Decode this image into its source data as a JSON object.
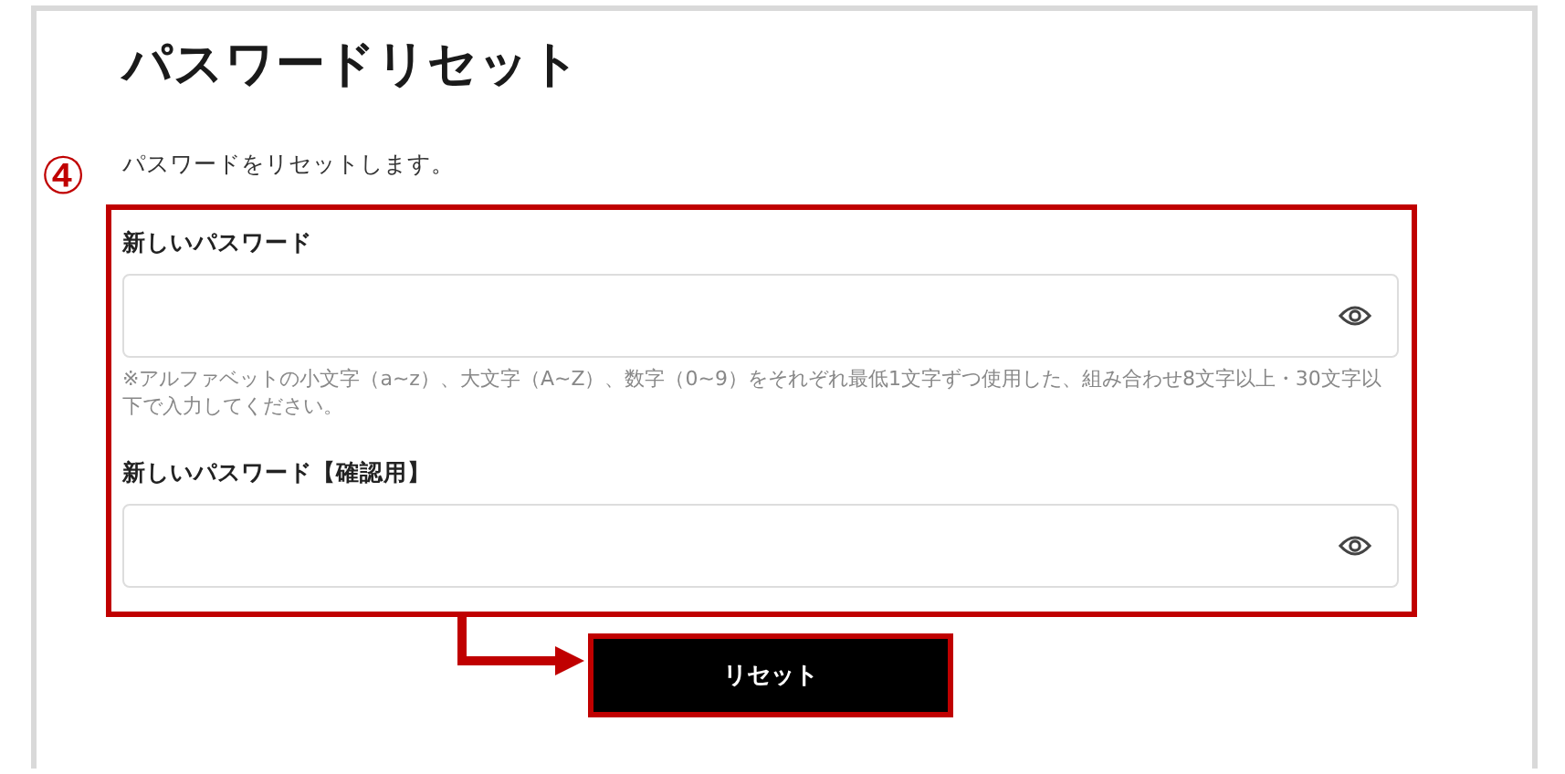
{
  "title": "パスワードリセット",
  "description": "パスワードをリセットします。",
  "annotation": {
    "marker": "④"
  },
  "fields": [
    {
      "label": "新しいパスワード",
      "hint": "※アルファベットの小文字（a~z）、大文字（A~Z）、数字（0~9）をそれぞれ最低1文字ずつ使用した、組み合わせ8文字以上・30文字以下で入力してください。"
    },
    {
      "label": "新しいパスワード【確認用】"
    }
  ],
  "submit_button": "リセット"
}
